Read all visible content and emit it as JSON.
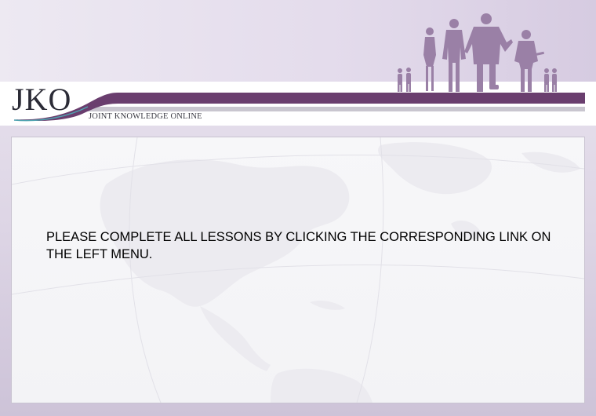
{
  "header": {
    "logo_text": "JKO",
    "logo_subtitle": "JOINT KNOWLEDGE ONLINE",
    "people_icon": "people-silhouettes-icon",
    "accent_color": "#6a3e6e"
  },
  "content": {
    "message": "PLEASE COMPLETE ALL LESSONS BY CLICKING THE CORRESPONDING LINK ON THE LEFT MENU.",
    "background_icon": "world-map-icon"
  }
}
